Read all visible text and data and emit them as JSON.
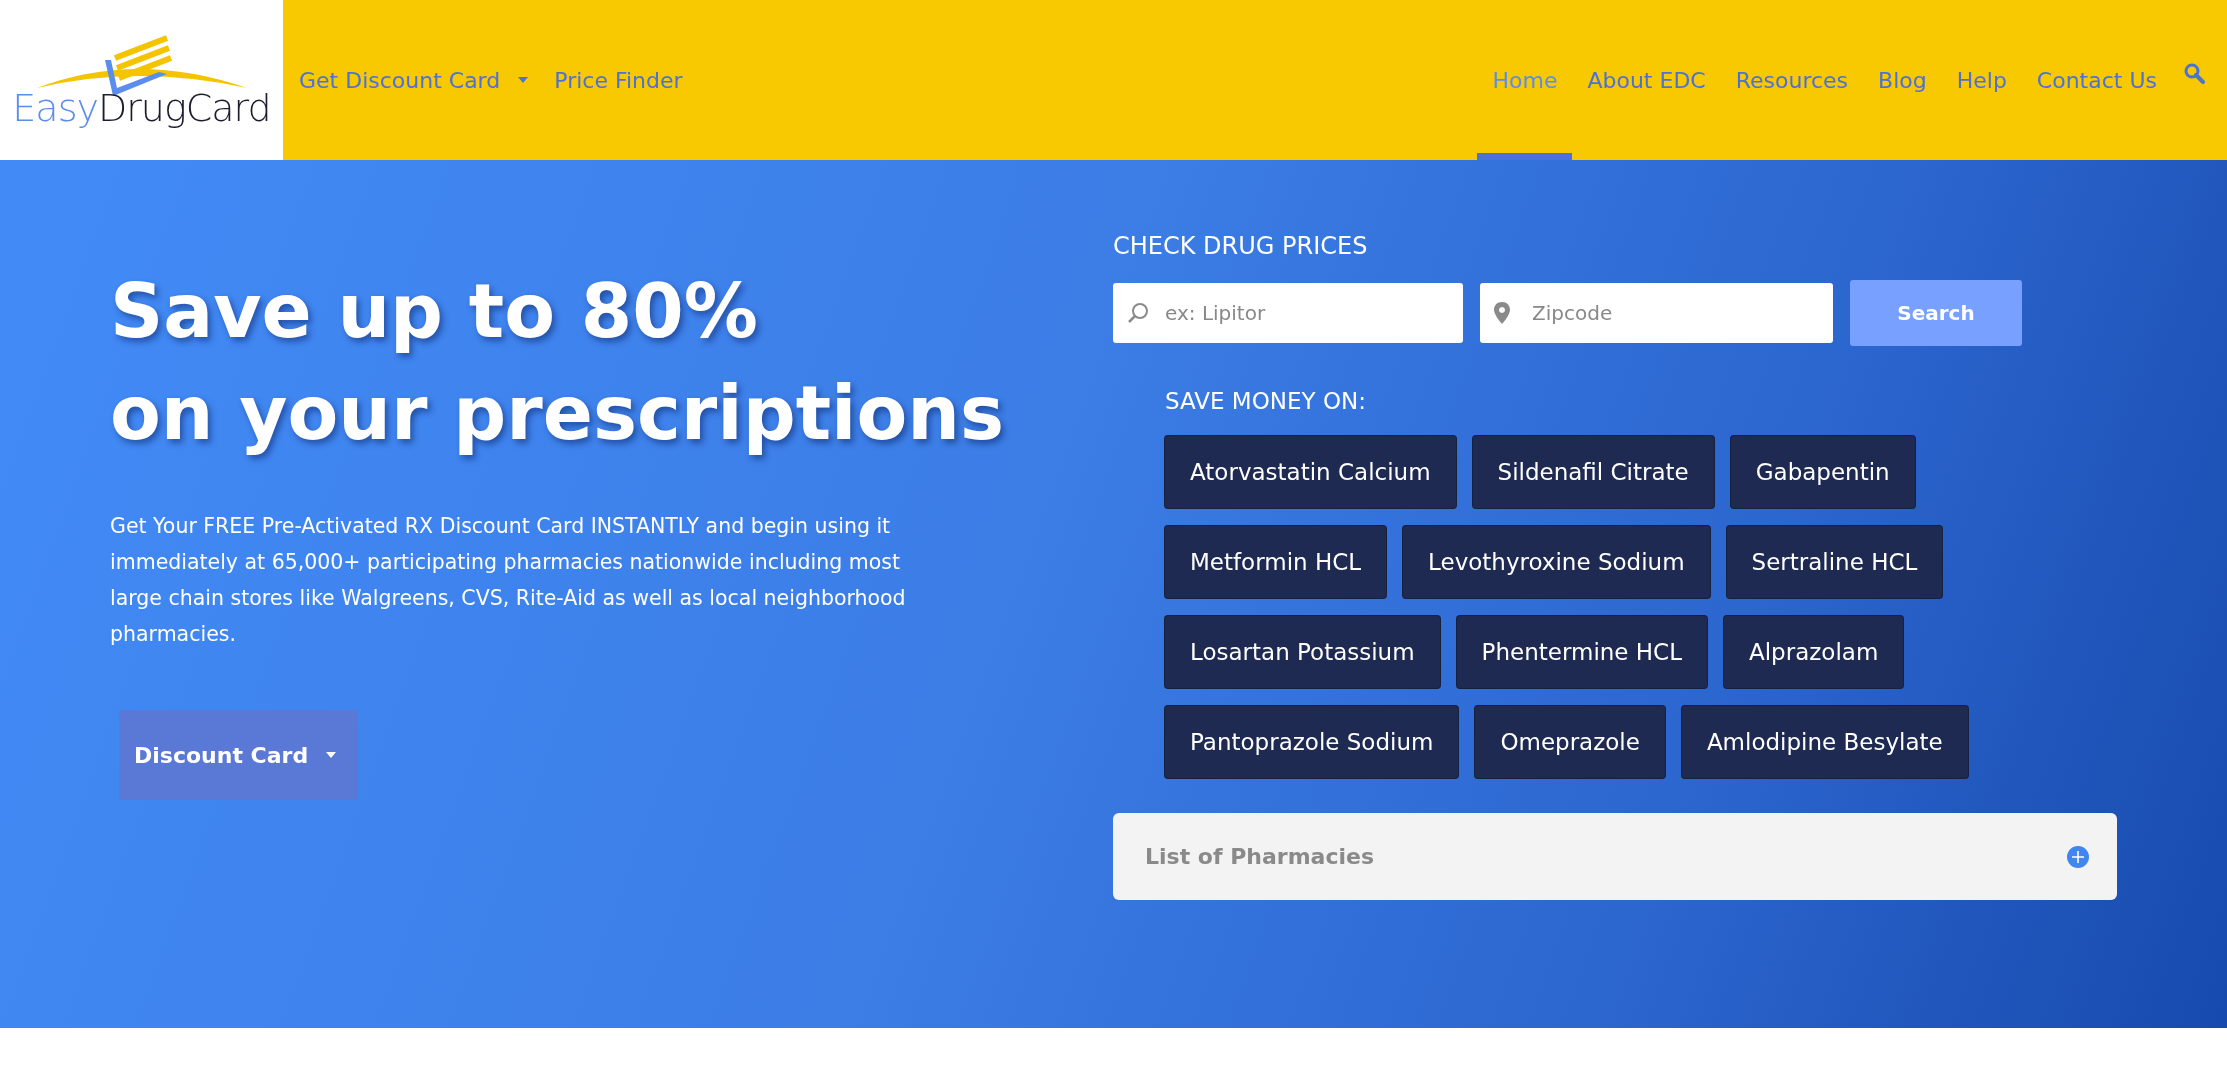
{
  "logo": {
    "wordmark": [
      "Easy",
      "DrugCard"
    ]
  },
  "nav_left": [
    {
      "label": "Get Discount Card",
      "has_menu": true
    },
    {
      "label": "Price Finder",
      "has_menu": false
    }
  ],
  "nav_right": [
    {
      "label": "Home",
      "selected": true
    },
    {
      "label": "About EDC",
      "selected": false
    },
    {
      "label": "Resources",
      "selected": false
    },
    {
      "label": "Blog",
      "selected": false
    },
    {
      "label": "Help",
      "selected": false
    },
    {
      "label": "Contact Us",
      "selected": false
    }
  ],
  "hero": {
    "headline": [
      "Save up to 80%",
      "on your prescriptions"
    ],
    "text": "Get Your FREE Pre-Activated RX Discount Card INSTANTLY and begin using it immediately at 65,000+ participating pharmacies nationwide including most large chain stores like Walgreens, CVS, Rite-Aid as well as local neighborhood pharmacies.",
    "button": {
      "label": "Discount Card",
      "has_menu": true
    }
  },
  "price_check": {
    "title": "CHECK DRUG PRICES",
    "drug_field": {
      "placeholder": "ex: Lipitor"
    },
    "zip_field": {
      "placeholder": "Zipcode"
    },
    "button": "Search",
    "save_title": "SAVE MONEY ON:",
    "drugs": [
      [
        "Atorvastatin Calcium",
        "Sildenafil Citrate",
        "Gabapentin"
      ],
      [
        "Metformin HCL",
        "Levothyroxine Sodium",
        "Sertraline HCL"
      ],
      [
        "Losartan Potassium",
        "Phentermine HCL",
        "Alprazolam"
      ],
      [
        "Pantoprazole Sodium",
        "Omeprazole",
        "Amlodipine Besylate"
      ]
    ],
    "accordion": {
      "label": "List of Pharmacies",
      "expanded": false
    }
  }
}
